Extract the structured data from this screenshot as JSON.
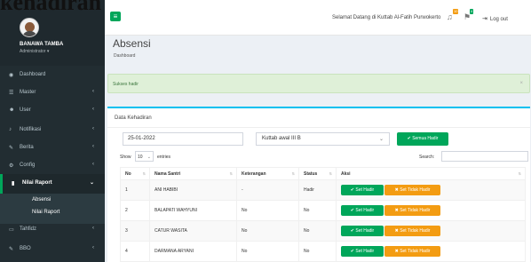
{
  "caption": "kehadiran",
  "sidebar": {
    "user_name": "BANAWA TAMBA",
    "user_role": "Administrator",
    "items": [
      {
        "label": "Dashboard",
        "icon": "dashboard-icon"
      },
      {
        "label": "Master",
        "icon": "list-icon"
      },
      {
        "label": "User",
        "icon": "users-icon"
      },
      {
        "label": "Notifikasi",
        "icon": "bell-icon"
      },
      {
        "label": "Berita",
        "icon": "edit-icon"
      },
      {
        "label": "Config",
        "icon": "sliders-icon"
      },
      {
        "label": "Nilai Raport",
        "icon": "book-icon"
      },
      {
        "label": "Tahfidz",
        "icon": "book-open-icon"
      },
      {
        "label": "BBO",
        "icon": "edit-icon"
      }
    ],
    "submenu": [
      "Absensi",
      "Nilai Raport"
    ]
  },
  "topbar": {
    "welcome": "Selamat Datang di Kuttab Al-Fatih Purwokerto",
    "badge_bell": "10",
    "badge_flag": "4",
    "logout": "Log out"
  },
  "main": {
    "title": "Absensi",
    "breadcrumb": "Dashboard",
    "alert": "Sukses hadir",
    "box_title": "Data Kehadiran",
    "date_value": "25-01-2022",
    "kuttab_value": "Kuttab awal III B",
    "btn_all": "✔ Semua Hadir",
    "show_label": "Show",
    "entries_value": "10",
    "entries_label": "entries",
    "search_label": "Search:",
    "columns": [
      "No",
      "Nama Santri",
      "Keterangan",
      "Status",
      "Aksi"
    ],
    "rows": [
      {
        "no": "1",
        "nama": "ANI HABIBI",
        "keterangan": "-",
        "status": "Hadir"
      },
      {
        "no": "2",
        "nama": "BALAPATI WAHYUNI",
        "keterangan": "No",
        "status": "No"
      },
      {
        "no": "3",
        "nama": "CATUR WASITA",
        "keterangan": "No",
        "status": "No"
      },
      {
        "no": "4",
        "nama": "DARMANA ARYANI",
        "keterangan": "No",
        "status": "No"
      }
    ],
    "btn_hadir": "✔ Set Hadir",
    "btn_tidak": "✖ Set Tidak Hadir"
  }
}
